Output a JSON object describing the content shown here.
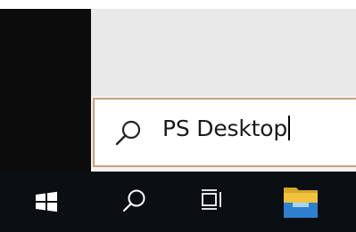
{
  "search": {
    "query": "PS Desktop",
    "icon": "search-icon"
  },
  "taskbar": {
    "items": [
      {
        "name": "start",
        "icon": "windows-logo-icon"
      },
      {
        "name": "search",
        "icon": "search-icon"
      },
      {
        "name": "task-view",
        "icon": "task-view-icon"
      },
      {
        "name": "file-explorer",
        "icon": "folder-icon"
      }
    ]
  },
  "colors": {
    "taskbar_bg": "#0a0f14",
    "start_rail_bg": "#0c0c0c",
    "search_border": "#c8a27a",
    "folder_yellow": "#f0c23e",
    "folder_blue": "#2f7fd0"
  }
}
